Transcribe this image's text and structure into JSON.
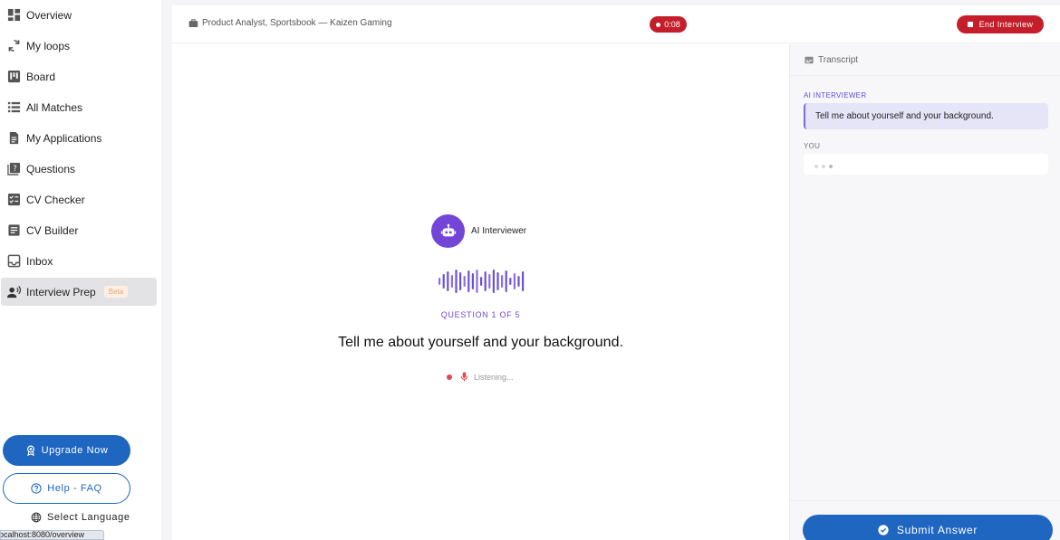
{
  "sidebar": {
    "items": [
      {
        "label": "Overview",
        "icon": "dashboard-icon"
      },
      {
        "label": "My loops",
        "icon": "sync-icon"
      },
      {
        "label": "Board",
        "icon": "kanban-board-icon"
      },
      {
        "label": "All Matches",
        "icon": "list-icon"
      },
      {
        "label": "My Applications",
        "icon": "document-icon"
      },
      {
        "label": "Questions",
        "icon": "question-book-icon"
      },
      {
        "label": "CV Checker",
        "icon": "checklist-icon"
      },
      {
        "label": "CV Builder",
        "icon": "article-icon"
      },
      {
        "label": "Inbox",
        "icon": "inbox-icon"
      },
      {
        "label": "Interview Prep",
        "icon": "record-voice-icon",
        "badge": "Beta",
        "active": true
      }
    ],
    "upgrade_label": "Upgrade Now",
    "help_label": "Help - FAQ",
    "language_label": "Select Language",
    "status_url": "localhost:8080/overview"
  },
  "header": {
    "job_title": "Product Analyst, Sportsbook — Kaizen Gaming",
    "timer": "0:08",
    "end_label": "End Interview"
  },
  "stage": {
    "interviewer_name": "AI Interviewer",
    "question_counter": "QUESTION 1 OF 5",
    "question": "Tell me about yourself and your background.",
    "status": "Listening..."
  },
  "transcript": {
    "title": "Transcript",
    "ai_label": "AI INTERVIEWER",
    "ai_message": "Tell me about yourself and your background.",
    "you_label": "YOU",
    "submit_label": "Submit Answer"
  },
  "colors": {
    "primary": "#1f66c1",
    "accent_purple": "#7446d8",
    "danger": "#c41e2a"
  }
}
